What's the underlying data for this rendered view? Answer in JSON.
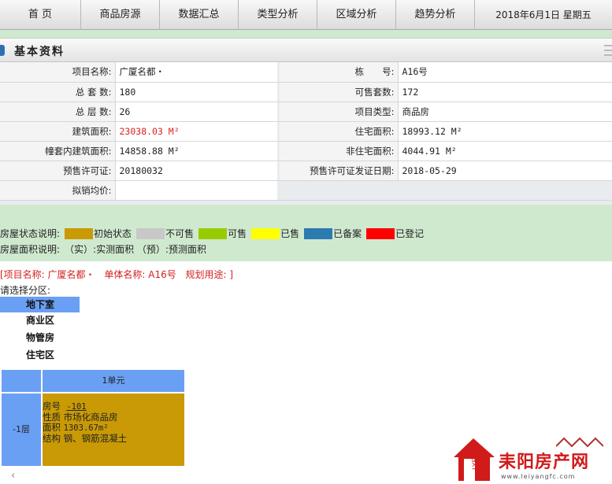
{
  "nav": {
    "items": [
      "首 页",
      "商品房源",
      "数据汇总",
      "类型分析",
      "区域分析",
      "趋势分析"
    ],
    "date": "2018年6月1日   星期五"
  },
  "section": {
    "title": "基本资料"
  },
  "info": {
    "rows": [
      {
        "l1": "项目名称:",
        "v1": "广厦名都・",
        "l2": "栋　　号:",
        "v2": "A16号"
      },
      {
        "l1": "总 套 数:",
        "v1": "180",
        "l2": "可售套数:",
        "v2": "172"
      },
      {
        "l1": "总 层 数:",
        "v1": "26",
        "l2": "项目类型:",
        "v2": "商品房"
      },
      {
        "l1": "建筑面积:",
        "v1": "23038.03 M²",
        "l2": "住宅面积:",
        "v2": "18993.12 M²"
      },
      {
        "l1": "幢套内建筑面积:",
        "v1": "14858.88 M²",
        "l2": "非住宅面积:",
        "v2": "4044.91 M²"
      },
      {
        "l1": "预售许可证:",
        "v1": "20180032",
        "l2": "预售许可证发证日期:",
        "v2": "2018-05-29"
      },
      {
        "l1": "拟销均价:",
        "v1": "",
        "l2": "",
        "v2": ""
      }
    ],
    "colors": {
      "highlight": "#e02020"
    }
  },
  "legend": {
    "status_label": "房屋状态说明:",
    "statuses": [
      {
        "label": "初始状态",
        "color": "#c99a05"
      },
      {
        "label": "不可售",
        "color": "#c8c8c8"
      },
      {
        "label": "可售",
        "color": "#99cc00"
      },
      {
        "label": "已售",
        "color": "#ffff00"
      },
      {
        "label": "已备案",
        "color": "#2b7bb0"
      },
      {
        "label": "已登记",
        "color": "#ff0000"
      }
    ],
    "area_label": "房屋面积说明:",
    "area_text": "（实）:实测面积 （预）:预测面积"
  },
  "project": {
    "name": "[项目名称: 广厦名都・",
    "unit": "单体名称: A16号",
    "use": "规划用途: ]"
  },
  "zones": {
    "label": "请选择分区:",
    "items": [
      "地下室",
      "商业区",
      "物管房",
      "住宅区"
    ],
    "active": "地下室"
  },
  "grid": {
    "unit_header": "1单元",
    "floor": "-1层",
    "room": {
      "no_label": "房号",
      "no": "-101",
      "nature_label": "性质",
      "nature": "市场化商品房",
      "area_label": "面积",
      "area": "1303.67m²",
      "struct_label": "结构",
      "struct": "钢、钢筋混凝土",
      "color": "#c99a05"
    }
  },
  "scroll": {
    "left_icon": "‹"
  },
  "watermark": {
    "title": "耒阳房产网",
    "url": "www.leiyangfc.com",
    "logo_text": "LYFC"
  }
}
